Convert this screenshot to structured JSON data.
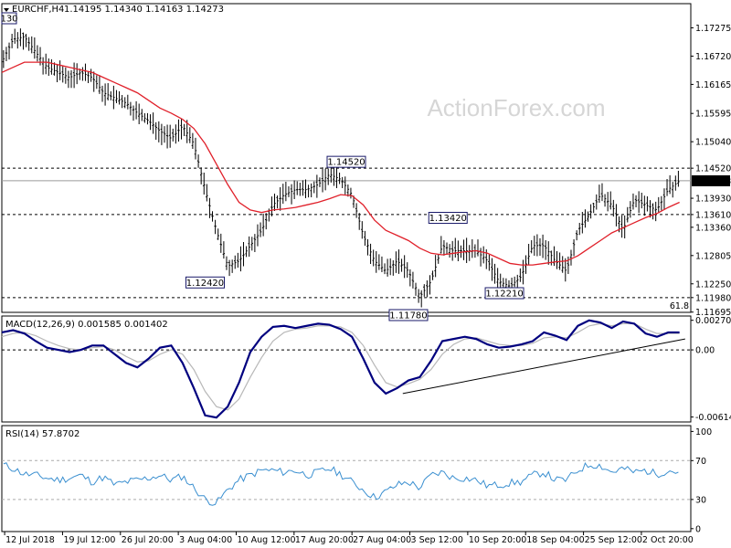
{
  "header": {
    "symbol": "EURCHF,H4",
    "ohlc": "1.14195 1.14340 1.14163 1.14273",
    "corner_label": "130"
  },
  "watermark": "ActionForex.com",
  "colors": {
    "price": "#000000",
    "ma": "#e0202a",
    "macd": "#00007f",
    "signal": "#b8b8b8",
    "rsi": "#3a8fd0",
    "level_dash": "#000000",
    "border": "#000000"
  },
  "price_panel": {
    "ylim": [
      1.1169,
      1.1775
    ],
    "y_ticks": [
      "1.17275",
      "1.16720",
      "1.16165",
      "1.15595",
      "1.15040",
      "1.14520",
      "1.14273",
      "1.13930",
      "1.13610",
      "1.13360",
      "1.12805",
      "1.12250",
      "1.11980",
      "1.11695"
    ],
    "current_price": "1.14273",
    "levels": [
      {
        "value": 1.1452,
        "label": "1.14520"
      },
      {
        "value": 1.1361,
        "label": "1.13610"
      },
      {
        "value": 1.1198,
        "label": "1.11980"
      }
    ],
    "annotations": [
      {
        "label": "1.14520",
        "x": 61,
        "y": 1.1452
      },
      {
        "label": "1.13420",
        "x": 79,
        "y": 1.1342
      },
      {
        "label": "1.12420",
        "x": 36,
        "y": 1.1242
      },
      {
        "label": "1.12210",
        "x": 89,
        "y": 1.1221
      },
      {
        "label": "1.11780",
        "x": 72,
        "y": 1.1178
      }
    ],
    "fib_label": "61.8"
  },
  "macd_panel": {
    "label": "MACD(12,26,9) 0.001585 0.001402",
    "y_ticks": [
      "0.002708",
      "0.00",
      "-0.006148"
    ],
    "ylim": [
      -0.0066,
      0.0031
    ]
  },
  "rsi_panel": {
    "label": "RSI(14) 57.8702",
    "y_ticks": [
      "100",
      "70",
      "30",
      "0"
    ],
    "ylim": [
      0,
      100
    ]
  },
  "x_labels": [
    "12 Jul 2018",
    "19 Jul 12:00",
    "26 Jul 20:00",
    "3 Aug 04:00",
    "10 Aug 12:00",
    "17 Aug 20:00",
    "27 Aug 04:00",
    "3 Sep 12:00",
    "10 Sep 20:00",
    "18 Sep 04:00",
    "25 Sep 12:00",
    "2 Oct 20:00"
  ],
  "chart_data": {
    "type": "line",
    "title": "EURCHF,H4",
    "x": [
      0,
      2,
      4,
      6,
      8,
      10,
      12,
      14,
      16,
      18,
      20,
      22,
      24,
      26,
      28,
      30,
      32,
      34,
      36,
      38,
      40,
      42,
      44,
      46,
      48,
      50,
      52,
      54,
      56,
      58,
      60,
      62,
      64,
      66,
      68,
      70,
      72,
      74,
      76,
      78,
      80,
      82,
      84,
      86,
      88,
      90,
      92,
      94,
      96,
      98,
      100,
      102,
      104,
      106,
      108,
      110,
      112,
      114,
      116,
      118,
      120
    ],
    "series": [
      {
        "values": [
          1.166,
          1.1705,
          1.171,
          1.168,
          1.165,
          1.164,
          1.163,
          1.164,
          1.163,
          1.16,
          1.159,
          1.158,
          1.156,
          1.1545,
          1.1525,
          1.151,
          1.1535,
          1.15,
          1.141,
          1.133,
          1.126,
          1.127,
          1.13,
          1.133,
          1.138,
          1.14,
          1.141,
          1.141,
          1.142,
          1.144,
          1.143,
          1.14,
          1.132,
          1.127,
          1.125,
          1.127,
          1.125,
          1.12,
          1.123,
          1.13,
          1.129,
          1.129,
          1.129,
          1.127,
          1.123,
          1.122,
          1.124,
          1.13,
          1.13,
          1.127,
          1.125,
          1.133,
          1.136,
          1.14,
          1.138,
          1.133,
          1.139,
          1.138,
          1.137,
          1.141,
          1.1427
        ]
      },
      {
        "values": [
          1.164,
          1.165,
          1.166,
          1.166,
          1.166,
          1.1655,
          1.165,
          1.1645,
          1.164,
          1.163,
          1.162,
          1.161,
          1.16,
          1.1585,
          1.157,
          1.156,
          1.1548,
          1.153,
          1.15,
          1.146,
          1.142,
          1.1385,
          1.137,
          1.1365,
          1.137,
          1.1372,
          1.1375,
          1.138,
          1.1385,
          1.1392,
          1.14,
          1.1398,
          1.138,
          1.135,
          1.133,
          1.132,
          1.131,
          1.1295,
          1.1285,
          1.1282,
          1.1285,
          1.1288,
          1.129,
          1.1285,
          1.1275,
          1.1265,
          1.1262,
          1.1262,
          1.1265,
          1.1268,
          1.127,
          1.128,
          1.1295,
          1.131,
          1.1325,
          1.1335,
          1.1345,
          1.1355,
          1.1363,
          1.1375,
          1.1385
        ]
      }
    ],
    "macd": [
      0.0016,
      0.0018,
      0.0015,
      0.0008,
      0.0002,
      0.0,
      -0.0002,
      0.0,
      0.0004,
      0.0004,
      -0.0004,
      -0.0012,
      -0.0016,
      -0.0008,
      0.0002,
      0.0004,
      -0.0012,
      -0.0035,
      -0.006,
      -0.0062,
      -0.0052,
      -0.003,
      -0.0002,
      0.0012,
      0.0021,
      0.0022,
      0.002,
      0.0022,
      0.0024,
      0.0023,
      0.0019,
      0.0012,
      -0.0008,
      -0.003,
      -0.004,
      -0.0035,
      -0.0028,
      -0.0025,
      -0.001,
      0.0008,
      0.001,
      0.0012,
      0.001,
      0.0005,
      0.0002,
      0.0003,
      0.0005,
      0.0008,
      0.0016,
      0.0013,
      0.0009,
      0.0022,
      0.0027,
      0.0025,
      0.002,
      0.0026,
      0.0024,
      0.0015,
      0.0012,
      0.0016,
      0.0016
    ],
    "signal": [
      0.0012,
      0.0015,
      0.0016,
      0.0013,
      0.0008,
      0.0004,
      0.0001,
      0.0,
      0.0002,
      0.0003,
      0.0,
      -0.0006,
      -0.0011,
      -0.001,
      -0.0004,
      0.0,
      -0.0004,
      -0.0018,
      -0.0038,
      -0.0052,
      -0.0055,
      -0.0045,
      -0.0025,
      -0.0007,
      0.0008,
      0.0016,
      0.0019,
      0.002,
      0.0022,
      0.0022,
      0.0021,
      0.0016,
      0.0004,
      -0.0014,
      -0.003,
      -0.0034,
      -0.0031,
      -0.0027,
      -0.0018,
      -0.0004,
      0.0005,
      0.001,
      0.0011,
      0.0008,
      0.0005,
      0.0004,
      0.0004,
      0.0006,
      0.0011,
      0.0012,
      0.0011,
      0.0016,
      0.0022,
      0.0024,
      0.0022,
      0.0024,
      0.0024,
      0.0019,
      0.0015,
      0.0015,
      0.0015
    ],
    "rsi": [
      66,
      62,
      56,
      55,
      52,
      50,
      52,
      55,
      48,
      53,
      45,
      48,
      50,
      52,
      55,
      50,
      54,
      42,
      30,
      26,
      40,
      50,
      55,
      60,
      60,
      58,
      60,
      55,
      58,
      62,
      56,
      48,
      40,
      32,
      38,
      45,
      48,
      42,
      55,
      58,
      52,
      52,
      50,
      44,
      45,
      47,
      48,
      55,
      58,
      50,
      50,
      60,
      66,
      65,
      58,
      62,
      58,
      60,
      56,
      60,
      58
    ]
  }
}
